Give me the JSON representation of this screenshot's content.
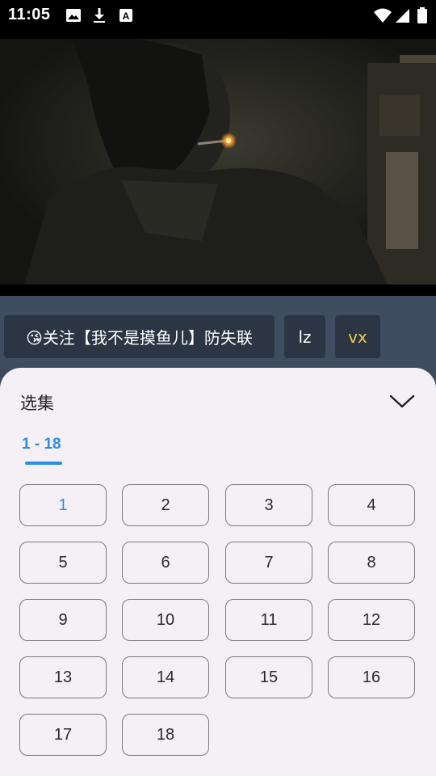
{
  "status_bar": {
    "time": "11:05",
    "icons": [
      "image-icon",
      "download-icon",
      "a-font-icon",
      "wifi-icon",
      "signal-icon",
      "battery-icon"
    ]
  },
  "video": {
    "description_icon": "video-frame"
  },
  "chips": [
    {
      "label": "😘关注【我不是摸鱼儿】防失联",
      "color": "#ffffff"
    },
    {
      "label": "lz",
      "color": "#ffffff"
    },
    {
      "label": "vx",
      "color": "#f2c94c"
    }
  ],
  "sheet": {
    "title": "选集",
    "range_tab": "1 - 18",
    "selected_episode": "1",
    "episodes": [
      "1",
      "2",
      "3",
      "4",
      "5",
      "6",
      "7",
      "8",
      "9",
      "10",
      "11",
      "12",
      "13",
      "14",
      "15",
      "16",
      "17",
      "18"
    ]
  },
  "colors": {
    "accent": "#2b8fe6",
    "sheet_bg": "#f4f0f6",
    "chip_bg": "#2b3544",
    "vx_label": "#f2c94c"
  }
}
